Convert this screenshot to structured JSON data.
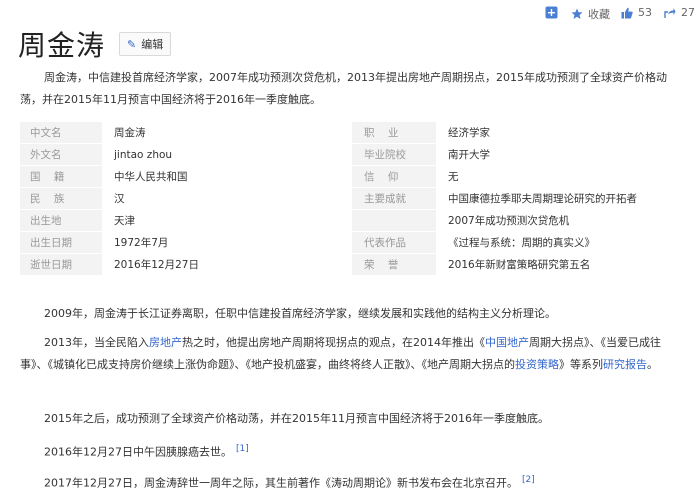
{
  "toolbar": {
    "favorite_label": "收藏",
    "like_count": "53",
    "share_count": "27"
  },
  "header": {
    "title": "周金涛",
    "edit_label": "编辑"
  },
  "summary": "周金涛，中信建投首席经济学家，2007年成功预测次贷危机，2013年提出房地产周期拐点，2015年成功预测了全球资产价格动荡，并在2015年11月预言中国经济将于2016年一季度触底。",
  "info_rows": [
    {
      "k1": "中文名",
      "v1": "周金涛",
      "k2": "职    业",
      "v2": "经济学家"
    },
    {
      "k1": "外文名",
      "v1": "jintao zhou",
      "k2": "毕业院校",
      "v2": "南开大学"
    },
    {
      "k1": "国    籍",
      "v1": "中华人民共和国",
      "k2": "信    仰",
      "v2": "无"
    },
    {
      "k1": "民    族",
      "v1": "汉",
      "k2": "主要成就",
      "v2": "中国康德拉季耶夫周期理论研究的开拓者"
    },
    {
      "k1": "出生地",
      "v1": "天津",
      "k2": "",
      "v2": "2007年成功预测次贷危机"
    },
    {
      "k1": "出生日期",
      "v1": "1972年7月",
      "k2": "代表作品",
      "v2": "《过程与系统：周期的真实义》"
    },
    {
      "k1": "逝世日期",
      "v1": "2016年12月27日",
      "k2": "荣    誉",
      "v2": "2016年新财富策略研究第五名"
    }
  ],
  "body": {
    "p1": "2009年，周金涛于长江证券离职，任职中信建投首席经济学家，继续发展和实践他的结构主义分析理论。",
    "p2a": "2013年，当全民陷入",
    "p2_link1": "房地产",
    "p2b": "热之时，他提出房地产周期将现拐点的观点，在2014年推出《",
    "p2_link2": "中国地产",
    "p2c": "周期大拐点》、《当爱已成往事》、《城镇化已成支持房价继续上涨伪命题》、《地产投机盛宴，曲终将终人正散》、《地产周期大拐点的",
    "p2_link3": "投资策略",
    "p2d": "》等系列",
    "p2_link4": "研究报告",
    "p2e": "。",
    "p3": "2015年之后，成功预测了全球资产价格动荡，并在2015年11月预言中国经济将于2016年一季度触底。",
    "p4": "2016年12月27日中午因胰腺癌去世。",
    "p4_ref": "[1]",
    "p5": "2017年12月27日，周金涛辞世一周年之际，其生前著作《涛动周期论》新书发布会在北京召开。",
    "p5_ref": "[2]"
  }
}
